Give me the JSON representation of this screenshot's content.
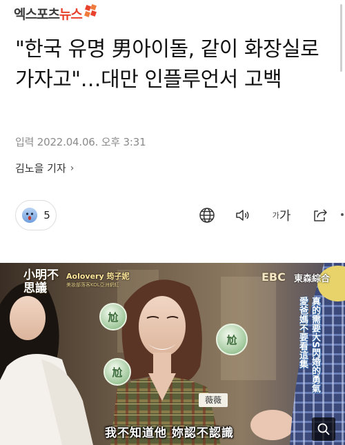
{
  "site": {
    "logo_main": "엑스포츠",
    "logo_accent": "뉴스"
  },
  "article": {
    "title": "\"한국 유명 男아이돌, 같이 화장실로 가자고\"…대만 인플루언서 고백",
    "dateline": "입력 2022.04.06. 오후 3:31",
    "reporter": "김노을 기자",
    "reporter_chevron": "›"
  },
  "toolbar": {
    "reaction_count": "5",
    "font_small": "가",
    "font_big": "가"
  },
  "photo": {
    "show_title": "小明不思議",
    "guest_label": "Aolovery 筠子妮",
    "guest_sub": "美妝部落客KOL亞洲網紅",
    "channel_logo": "EBC",
    "channel_name": "東森綜合",
    "name_tag": "薇薇",
    "caption": "我不知道他 妳認不認識",
    "side_caption_1": "愛爸媽不要看這集",
    "side_caption_2": "真的需要大S閃婚的勇氣",
    "side_caption_3": "",
    "bubble_text": "尬"
  },
  "colors": {
    "accent": "#e8412c",
    "text": "#111111",
    "muted": "#8a8a8a"
  }
}
